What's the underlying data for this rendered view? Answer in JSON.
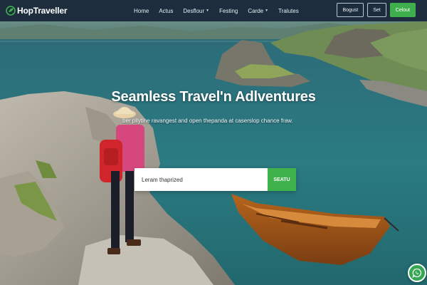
{
  "brand": {
    "name": "HopTraveller",
    "icon": "leaf-logo-icon",
    "color": "#3fae4c"
  },
  "nav": {
    "items": [
      {
        "label": "Home",
        "dropdown": false
      },
      {
        "label": "Actus",
        "dropdown": false
      },
      {
        "label": "Desflour",
        "dropdown": true
      },
      {
        "label": "Festing",
        "dropdown": false
      },
      {
        "label": "Carde",
        "dropdown": true
      },
      {
        "label": "Tralutes",
        "dropdown": false
      }
    ],
    "actions": {
      "outline_1": "Bogust",
      "outline_2": "Set",
      "primary": "Celout"
    }
  },
  "hero": {
    "title": "Seamless Travel'n Adlventures",
    "subtitle": "ber pllytine ravangest and open thepanda at caserslop chance fraw.",
    "search": {
      "value": "Leram thaprized",
      "button": "SEATU"
    }
  },
  "chat": {
    "icon": "chat-bubble-icon"
  },
  "colors": {
    "navbar": "#1d2d3e",
    "accent": "#3fae4c"
  }
}
